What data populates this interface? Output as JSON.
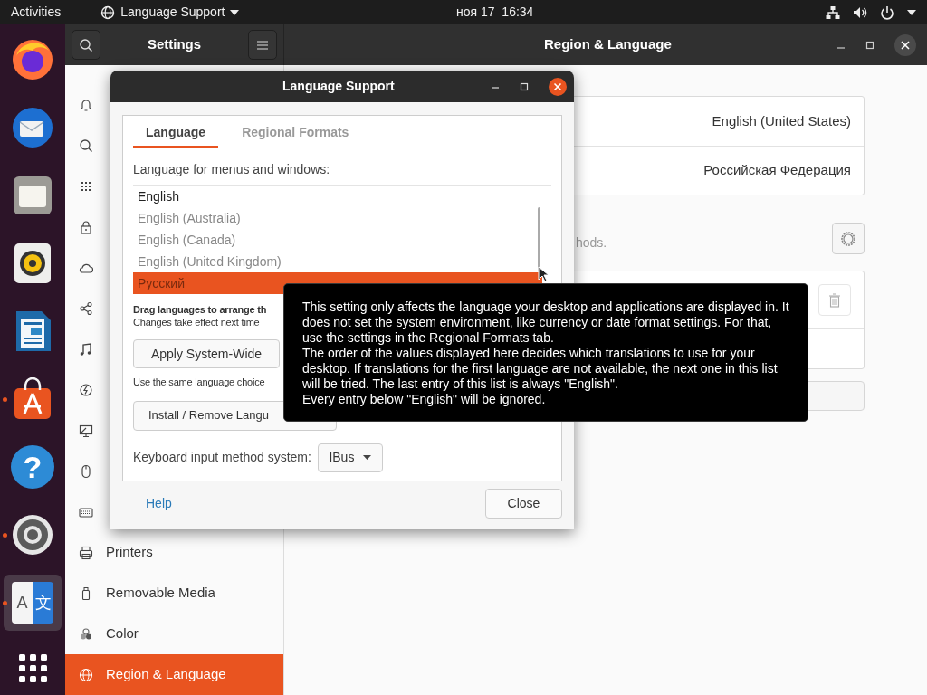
{
  "top_bar": {
    "activities": "Activities",
    "app_menu": "Language Support",
    "clock": "ноя 17  16:34"
  },
  "dock": [
    {
      "kind": "firefox",
      "running": false,
      "selected": false
    },
    {
      "kind": "thunderbird",
      "running": false,
      "selected": false
    },
    {
      "kind": "files",
      "running": false,
      "selected": false
    },
    {
      "kind": "rhythmbox",
      "running": false,
      "selected": false
    },
    {
      "kind": "writer",
      "running": false,
      "selected": false
    },
    {
      "kind": "software",
      "running": true,
      "selected": false
    },
    {
      "kind": "help",
      "glyph": "?",
      "running": false,
      "selected": false
    },
    {
      "kind": "settings",
      "running": true,
      "selected": false
    },
    {
      "kind": "language",
      "glyphs": [
        "A",
        "文"
      ],
      "running": true,
      "selected": true
    }
  ],
  "settings_window": {
    "title": "Settings",
    "page_title": "Region & Language",
    "sidebar": [
      {
        "kind": "bell",
        "selected": false
      },
      {
        "kind": "search",
        "selected": false
      },
      {
        "kind": "apps",
        "selected": false
      },
      {
        "kind": "lock",
        "selected": false
      },
      {
        "kind": "cloud",
        "selected": false
      },
      {
        "kind": "share",
        "selected": false
      },
      {
        "kind": "music",
        "selected": false
      },
      {
        "kind": "power",
        "selected": false
      },
      {
        "kind": "display",
        "selected": false
      },
      {
        "kind": "mouse",
        "selected": false
      },
      {
        "kind": "keyboard",
        "selected": false
      },
      {
        "kind": "printer",
        "label": "Printers",
        "selected": false
      },
      {
        "kind": "usb",
        "label": "Removable Media",
        "selected": false
      },
      {
        "kind": "color",
        "label": "Color",
        "selected": false
      },
      {
        "kind": "globe",
        "label": "Region & Language",
        "selected": true
      }
    ],
    "rows": [
      {
        "value": "English (United States)"
      },
      {
        "value": "Российская Федерация"
      }
    ],
    "input_sources_hint": "hods."
  },
  "dialog": {
    "title": "Language Support",
    "tabs": [
      {
        "label": "Language",
        "selected": true
      },
      {
        "label": "Regional Formats",
        "selected": false
      }
    ],
    "list_label": "Language for menus and windows:",
    "languages": [
      {
        "label": "English",
        "selected": false,
        "active": true
      },
      {
        "label": "English (Australia)",
        "selected": false,
        "active": false
      },
      {
        "label": "English (Canada)",
        "selected": false,
        "active": false
      },
      {
        "label": "English (United Kingdom)",
        "selected": false,
        "active": false
      },
      {
        "label": "Русский",
        "selected": true,
        "active": false
      }
    ],
    "drag_hint": "Drag languages to arrange th",
    "changes_hint": "Changes take effect next time",
    "apply_button": "Apply System-Wide",
    "apply_hint": "Use the same language choice",
    "install_button": "Install / Remove Langu",
    "input_method_label": "Keyboard input method system:",
    "input_method_value": "IBus",
    "help": "Help",
    "close": "Close"
  },
  "tooltip": {
    "paragraphs": [
      "This setting only affects the language your desktop and applications are displayed in. It does not set the system environment, like currency or date format settings. For that, use the settings in the Regional Formats tab.",
      "The order of the values displayed here decides which translations to use for your desktop. If translations for the first language are not available, the next one in this list will be tried. The last entry of this list is always \"English\".",
      "Every entry below \"English\" will be ignored."
    ]
  }
}
